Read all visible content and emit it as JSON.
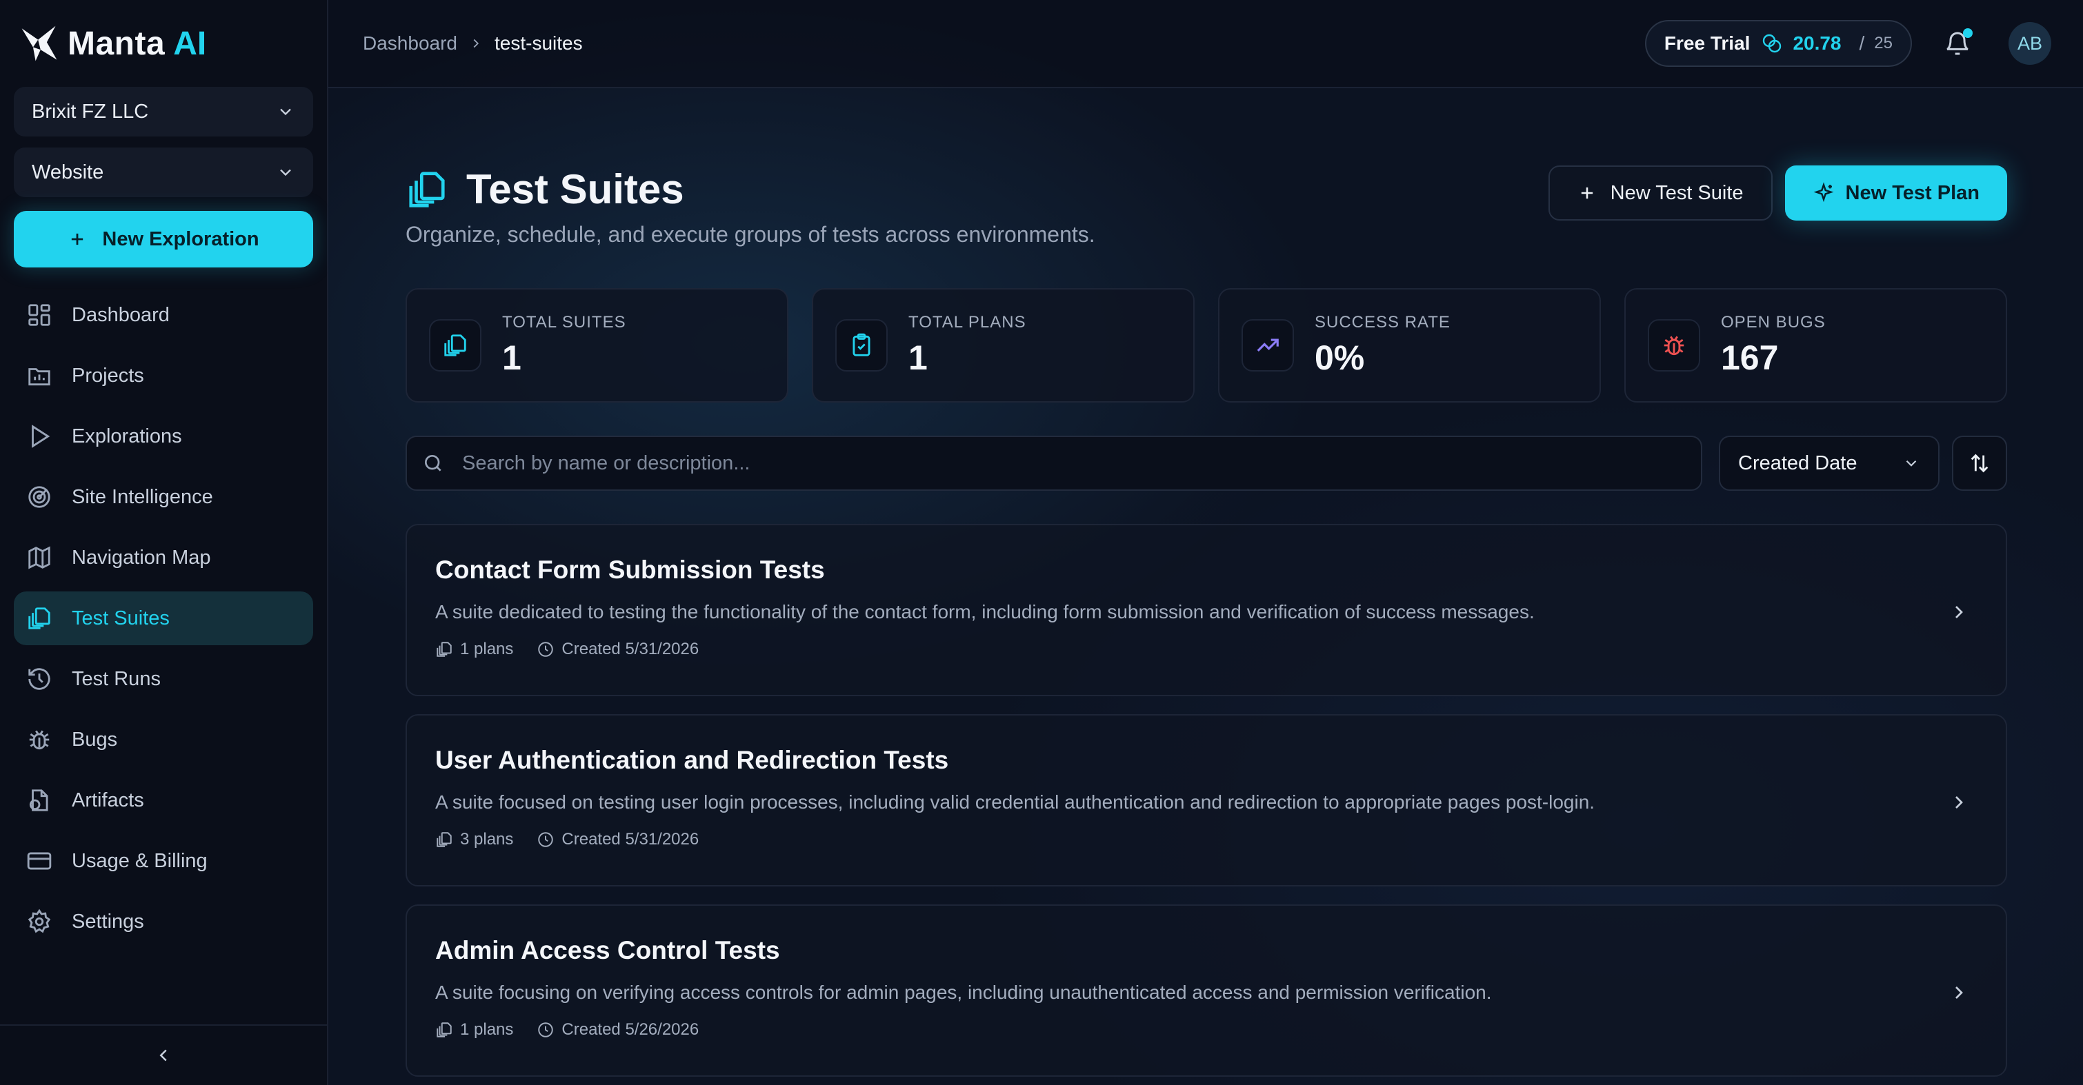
{
  "brand": {
    "name": "Manta",
    "accent": "AI",
    "accent_color": "#22d3ee"
  },
  "sidebar": {
    "org_select": "Brixit FZ LLC",
    "project_select": "Website",
    "new_exploration": "New Exploration",
    "items": [
      {
        "label": "Dashboard",
        "icon": "dashboard-grid-icon"
      },
      {
        "label": "Projects",
        "icon": "projects-icon"
      },
      {
        "label": "Explorations",
        "icon": "play-icon"
      },
      {
        "label": "Site Intelligence",
        "icon": "radar-icon"
      },
      {
        "label": "Navigation Map",
        "icon": "map-icon"
      },
      {
        "label": "Test Suites",
        "icon": "stack-icon",
        "active": true
      },
      {
        "label": "Test Runs",
        "icon": "history-icon"
      },
      {
        "label": "Bugs",
        "icon": "bug-icon"
      },
      {
        "label": "Artifacts",
        "icon": "artifact-icon"
      },
      {
        "label": "Usage & Billing",
        "icon": "credit-card-icon"
      },
      {
        "label": "Settings",
        "icon": "gear-icon"
      }
    ]
  },
  "topbar": {
    "breadcrumb": [
      "Dashboard",
      "test-suites"
    ],
    "trial": {
      "label": "Free Trial",
      "used": "20.78",
      "separator": "/",
      "limit": "25"
    },
    "avatar": "AB"
  },
  "page": {
    "title": "Test Suites",
    "subtitle": "Organize, schedule, and execute groups of tests across environments.",
    "new_suite": "New Test Suite",
    "new_plan": "New Test Plan"
  },
  "stats": [
    {
      "label": "TOTAL SUITES",
      "value": "1",
      "icon": "stack-icon",
      "color": "#22d3ee"
    },
    {
      "label": "TOTAL PLANS",
      "value": "1",
      "icon": "clipboard-check-icon",
      "color": "#22d3ee"
    },
    {
      "label": "SUCCESS RATE",
      "value": "0%",
      "icon": "trend-up-icon",
      "color": "#8b7cf6"
    },
    {
      "label": "OPEN BUGS",
      "value": "167",
      "icon": "bug-icon",
      "color": "#f05252"
    }
  ],
  "filters": {
    "search_placeholder": "Search by name or description...",
    "sort_by": "Created Date"
  },
  "suites": [
    {
      "title": "Contact Form Submission Tests",
      "description": "A suite dedicated to testing the functionality of the contact form, including form submission and verification of success messages.",
      "plans": "1 plans",
      "created": "Created 5/31/2026"
    },
    {
      "title": "User Authentication and Redirection Tests",
      "description": "A suite focused on testing user login processes, including valid credential authentication and redirection to appropriate pages post-login.",
      "plans": "3 plans",
      "created": "Created 5/31/2026"
    },
    {
      "title": "Admin Access Control Tests",
      "description": "A suite focusing on verifying access controls for admin pages, including unauthenticated access and permission verification.",
      "plans": "1 plans",
      "created": "Created 5/26/2026"
    }
  ]
}
